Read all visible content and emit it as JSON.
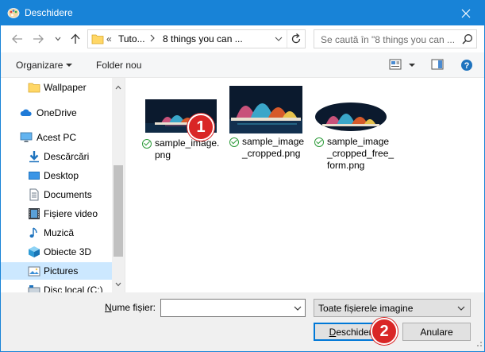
{
  "window": {
    "title": "Deschidere",
    "accent": "#1883d7"
  },
  "nav": {
    "breadcrumb_prefix": "«",
    "crumbs": [
      "Tuto...",
      "8 things you can ..."
    ],
    "search_placeholder": "Se caută în \"8 things you can ..."
  },
  "toolbar": {
    "organize": "Organizare",
    "new_folder": "Folder nou"
  },
  "sidebar": {
    "items": [
      {
        "label": "Wallpaper",
        "icon": "folder-icon"
      },
      {
        "label": "OneDrive",
        "icon": "cloud-icon"
      },
      {
        "label": "Acest PC",
        "icon": "computer-icon"
      },
      {
        "label": "Descărcări",
        "icon": "download-icon"
      },
      {
        "label": "Desktop",
        "icon": "desktop-icon"
      },
      {
        "label": "Documents",
        "icon": "documents-icon"
      },
      {
        "label": "Fișiere video",
        "icon": "video-icon"
      },
      {
        "label": "Muzică",
        "icon": "music-icon"
      },
      {
        "label": "Obiecte 3D",
        "icon": "cube-icon"
      },
      {
        "label": "Pictures",
        "icon": "pictures-icon",
        "selected": true
      },
      {
        "label": "Disc local (C:)",
        "icon": "drive-icon"
      }
    ]
  },
  "files": [
    {
      "line1": "sample_image.",
      "line2": "png",
      "line3": ""
    },
    {
      "line1": "sample_image",
      "line2": "_cropped.png",
      "line3": ""
    },
    {
      "line1": "sample_image",
      "line2": "_cropped_free_",
      "line3": "form.png"
    }
  ],
  "annotations": {
    "badge1": "1",
    "badge2": "2",
    "color": "#d92626"
  },
  "bottom": {
    "filename_label_u": "N",
    "filename_label_rest": "ume fișier:",
    "filename_value": "",
    "filter_value": "Toate fișierele imagine",
    "open_u": "D",
    "open_rest": "eschidere",
    "cancel": "Anulare"
  }
}
